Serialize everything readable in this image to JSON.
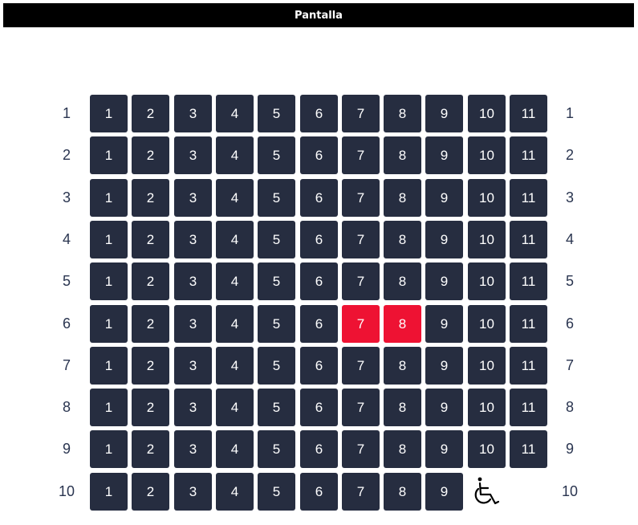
{
  "screen": {
    "label": "Pantalla"
  },
  "seats_per_row": 11,
  "rows": [
    {
      "label": "1",
      "seats": [
        "1",
        "2",
        "3",
        "4",
        "5",
        "6",
        "7",
        "8",
        "9",
        "10",
        "11"
      ]
    },
    {
      "label": "2",
      "seats": [
        "1",
        "2",
        "3",
        "4",
        "5",
        "6",
        "7",
        "8",
        "9",
        "10",
        "11"
      ]
    },
    {
      "label": "3",
      "seats": [
        "1",
        "2",
        "3",
        "4",
        "5",
        "6",
        "7",
        "8",
        "9",
        "10",
        "11"
      ]
    },
    {
      "label": "4",
      "seats": [
        "1",
        "2",
        "3",
        "4",
        "5",
        "6",
        "7",
        "8",
        "9",
        "10",
        "11"
      ]
    },
    {
      "label": "5",
      "seats": [
        "1",
        "2",
        "3",
        "4",
        "5",
        "6",
        "7",
        "8",
        "9",
        "10",
        "11"
      ]
    },
    {
      "label": "6",
      "seats": [
        "1",
        "2",
        "3",
        "4",
        "5",
        "6",
        "7",
        "8",
        "9",
        "10",
        "11"
      ],
      "selected": [
        "7",
        "8"
      ]
    },
    {
      "label": "7",
      "seats": [
        "1",
        "2",
        "3",
        "4",
        "5",
        "6",
        "7",
        "8",
        "9",
        "10",
        "11"
      ]
    },
    {
      "label": "8",
      "seats": [
        "1",
        "2",
        "3",
        "4",
        "5",
        "6",
        "7",
        "8",
        "9",
        "10",
        "11"
      ]
    },
    {
      "label": "9",
      "seats": [
        "1",
        "2",
        "3",
        "4",
        "5",
        "6",
        "7",
        "8",
        "9",
        "10",
        "11"
      ]
    },
    {
      "label": "10",
      "seats": [
        "1",
        "2",
        "3",
        "4",
        "5",
        "6",
        "7",
        "8",
        "9"
      ],
      "accessible_space": {
        "icon": "wheelchair-icon"
      }
    }
  ],
  "colors": {
    "seat_available": "#262d40",
    "seat_selected": "#ee1233",
    "row_label": "#2a3550",
    "screen_bar": "#000000"
  }
}
